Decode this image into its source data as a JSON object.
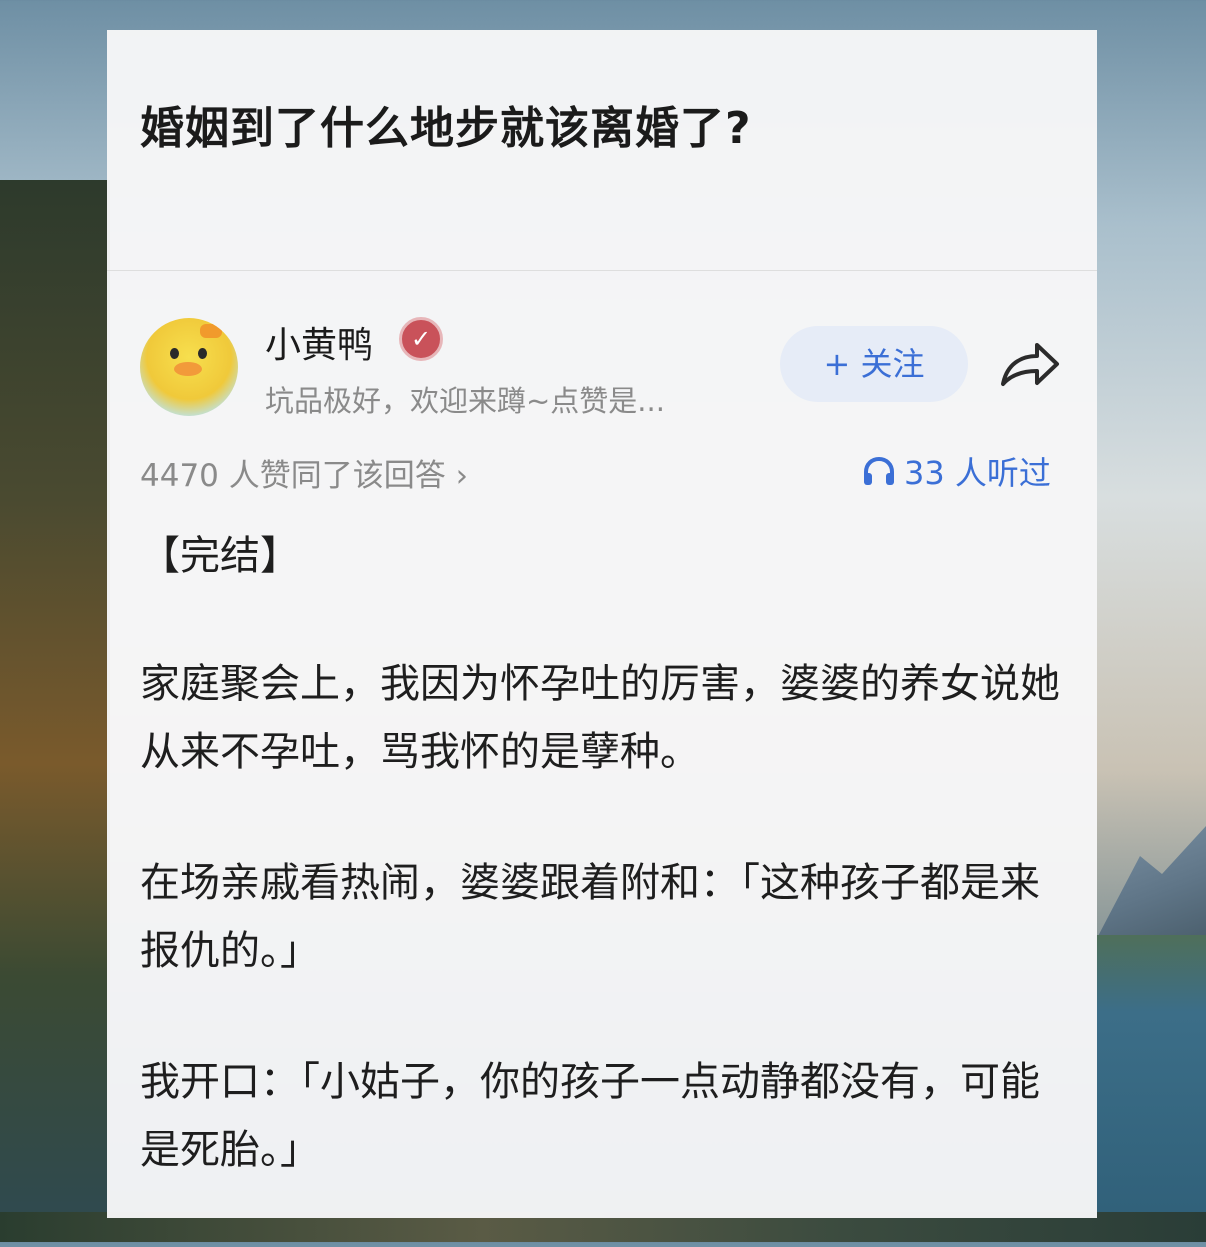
{
  "question": {
    "title": "婚姻到了什么地步就该离婚了?"
  },
  "author": {
    "name": "小黄鸭",
    "description": "坑品极好，欢迎来蹲~点赞是...",
    "follow_label": "+ 关注"
  },
  "stats": {
    "likes_text": "4470 人赞同了该回答 ›",
    "listen_text": "33 人听过"
  },
  "answer": {
    "paragraphs": [
      "【完结】",
      "家庭聚会上，我因为怀孕吐的厉害，婆婆的养女说她从来不孕吐，骂我怀的是孽种。",
      "在场亲戚看热闹，婆婆跟着附和：「这种孩子都是来报仇的。」",
      "我开口：「小姑子，你的孩子一点动静都没有，可能是死胎。」"
    ]
  },
  "colors": {
    "accent": "#3b6fd6",
    "follow_bg": "#e6ecf7",
    "badge": "#c9525a"
  }
}
